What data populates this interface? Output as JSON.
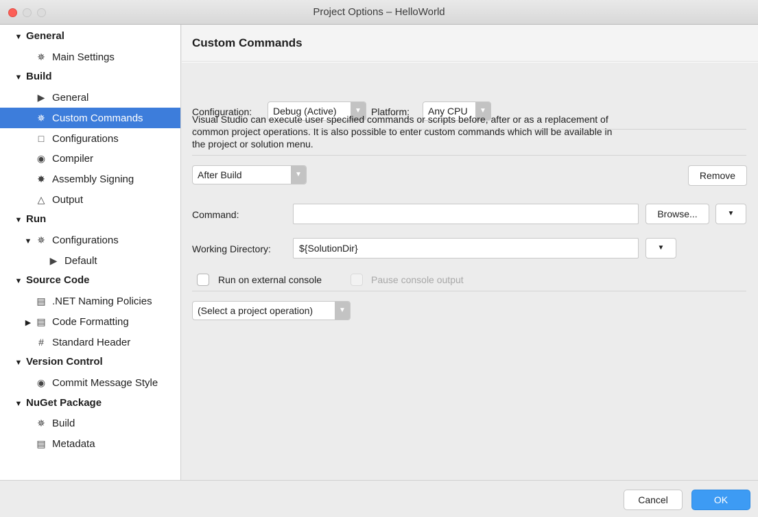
{
  "window": {
    "title": "Project Options – HelloWorld"
  },
  "sidebar": {
    "items": [
      {
        "label": "General",
        "type": "header",
        "toggle": "▼"
      },
      {
        "label": "Main Settings",
        "icon": "✵"
      },
      {
        "label": "Build",
        "type": "header",
        "toggle": "▼"
      },
      {
        "label": "General",
        "icon": "▶"
      },
      {
        "label": "Custom Commands",
        "icon": "✵",
        "selected": true
      },
      {
        "label": "Configurations",
        "icon": "□"
      },
      {
        "label": "Compiler",
        "icon": "◉"
      },
      {
        "label": "Assembly Signing",
        "icon": "✸"
      },
      {
        "label": "Output",
        "icon": "△"
      },
      {
        "label": "Run",
        "type": "header",
        "toggle": "▼"
      },
      {
        "label": "Configurations",
        "icon": "✵",
        "toggle": "▼"
      },
      {
        "label": "Default",
        "icon": "▶"
      },
      {
        "label": "Source Code",
        "type": "header",
        "toggle": "▼"
      },
      {
        "label": ".NET Naming Policies",
        "icon": "▤"
      },
      {
        "label": "Code Formatting",
        "icon": "▤",
        "toggle": "▶"
      },
      {
        "label": "Standard Header",
        "icon": "#"
      },
      {
        "label": "Version Control",
        "type": "header",
        "toggle": "▼"
      },
      {
        "label": "Commit Message Style",
        "icon": "◉"
      },
      {
        "label": "NuGet Package",
        "type": "header",
        "toggle": "▼"
      },
      {
        "label": "Build",
        "icon": "✵"
      },
      {
        "label": "Metadata",
        "icon": "▤"
      }
    ]
  },
  "main": {
    "title": "Custom Commands",
    "configuration_label": "Configuration:",
    "configuration_value": "Debug (Active)",
    "platform_label": "Platform:",
    "platform_value": "Any CPU",
    "description": "Visual Studio can execute user specified commands or scripts before, after or as a replacement of common project operations. It is also possible to enter custom commands which will be available in the project or solution menu.",
    "operation_value": "After Build",
    "remove_label": "Remove",
    "command_label": "Command:",
    "command_value": "",
    "browse_label": "Browse...",
    "working_dir_label": "Working Directory:",
    "working_dir_value": "${SolutionDir}",
    "external_console_label": "Run on external console",
    "pause_output_label": "Pause console output",
    "select_operation_value": "(Select a project operation)"
  },
  "footer": {
    "cancel_label": "Cancel",
    "ok_label": "OK"
  },
  "colors": {
    "selection": "#3d7ddb",
    "primary_button": "#3d9bf4",
    "close_button": "#fc5f57"
  }
}
